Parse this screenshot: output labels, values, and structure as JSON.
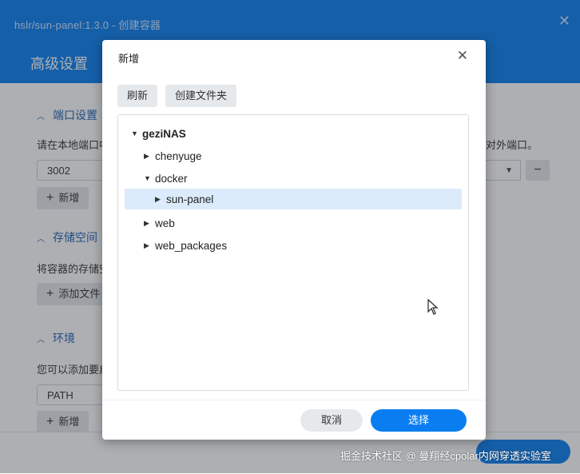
{
  "window": {
    "title": "hslr/sun-panel:1.3.0 - 创建容器",
    "close_glyph": "✕"
  },
  "header": {
    "title": "高级设置"
  },
  "sections": {
    "port": {
      "title": "端口设置",
      "desc": "请在本地端口中",
      "desc_right": "对外端口。",
      "port_value": "3002",
      "add_label": "新增",
      "minus_glyph": "−"
    },
    "storage": {
      "title": "存储空间",
      "desc": "将容器的存储空",
      "add_label": "添加文件"
    },
    "env": {
      "title": "环境",
      "desc": "您可以添加要启",
      "var_value": "PATH",
      "add_label": "新增"
    }
  },
  "dialog": {
    "title": "新增",
    "close_glyph": "✕",
    "refresh_label": "刷新",
    "new_folder_label": "创建文件夹",
    "tree": [
      {
        "label": "geziNAS",
        "arrow": "▼",
        "level": 0,
        "selected": false
      },
      {
        "label": "chenyuge",
        "arrow": "▶",
        "level": 1,
        "selected": false
      },
      {
        "label": "docker",
        "arrow": "▼",
        "level": 1,
        "selected": false
      },
      {
        "label": "sun-panel",
        "arrow": "▶",
        "level": 2,
        "selected": true
      },
      {
        "label": "web",
        "arrow": "▶",
        "level": 1,
        "selected": false
      },
      {
        "label": "web_packages",
        "arrow": "▶",
        "level": 1,
        "selected": false
      }
    ],
    "cancel_label": "取消",
    "select_label": "选择"
  },
  "watermark": "掘金技术社区 @ 曼翔经cpolar内网穿透实验室",
  "colors": {
    "accent": "#0a7ef0",
    "selected_row": "#dcebfb",
    "section_title": "#2262b8"
  }
}
